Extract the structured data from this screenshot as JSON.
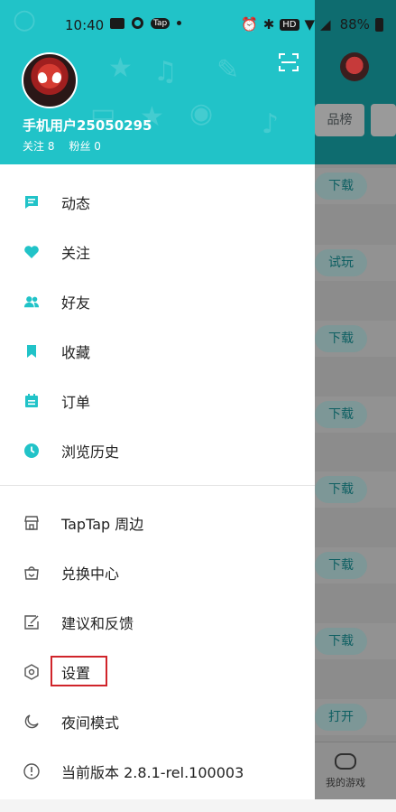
{
  "status_bar": {
    "time": "10:40",
    "tap_badge": "Tap",
    "hd_badge": "HD",
    "battery": "88%"
  },
  "profile": {
    "username": "手机用户25050295",
    "following_label": "关注 8",
    "fans_label": "粉丝 0"
  },
  "menu_primary": [
    {
      "label": "动态",
      "icon": "feed-icon"
    },
    {
      "label": "关注",
      "icon": "heart-icon"
    },
    {
      "label": "好友",
      "icon": "friends-icon"
    },
    {
      "label": "收藏",
      "icon": "bookmark-icon"
    },
    {
      "label": "订单",
      "icon": "orders-icon"
    },
    {
      "label": "浏览历史",
      "icon": "clock-icon"
    }
  ],
  "menu_secondary": [
    {
      "label": "TapTap 周边",
      "icon": "store-icon"
    },
    {
      "label": "兑换中心",
      "icon": "bag-icon"
    },
    {
      "label": "建议和反馈",
      "icon": "feedback-icon"
    },
    {
      "label": "设置",
      "icon": "settings-icon"
    },
    {
      "label": "夜间模式",
      "icon": "moon-icon"
    },
    {
      "label": "当前版本 2.8.1-rel.100003",
      "icon": "info-icon"
    }
  ],
  "background": {
    "tab_partial": "品榜",
    "buttons": [
      "下载",
      "试玩",
      "下载",
      "下载",
      "下载",
      "下载",
      "下载",
      "打开"
    ],
    "nav_label": "我的游戏"
  },
  "colors": {
    "accent": "#21c3c8",
    "highlight_box": "#d0242a"
  }
}
